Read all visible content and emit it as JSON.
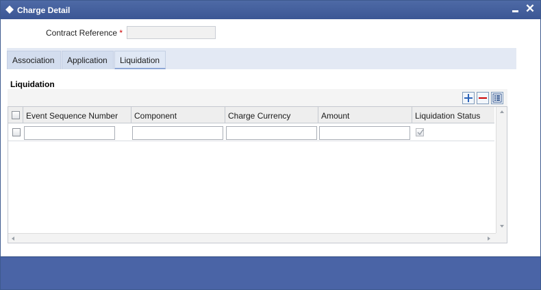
{
  "window": {
    "title": "Charge Detail",
    "title_icon": "diamond-icon",
    "minimize_icon": "minimize-icon",
    "close_icon": "close-icon",
    "close_glyph": "✕"
  },
  "header": {
    "contract_reference_label": "Contract Reference",
    "required_marker": "*",
    "contract_reference_value": ""
  },
  "tabs": [
    {
      "label": "Association"
    },
    {
      "label": "Application"
    },
    {
      "label": "Liquidation",
      "active": true
    }
  ],
  "section": {
    "title": "Liquidation"
  },
  "toolbar": {
    "add_icon": "plus-icon",
    "delete_icon": "minus-icon",
    "view_icon": "list-view-icon"
  },
  "grid": {
    "columns": [
      {
        "label": "Event Sequence Number"
      },
      {
        "label": "Component"
      },
      {
        "label": "Charge Currency"
      },
      {
        "label": "Amount"
      },
      {
        "label": "Liquidation Status"
      }
    ],
    "rows": [
      {
        "selected": false,
        "event_sequence_number": "",
        "component": "",
        "charge_currency": "",
        "amount": "",
        "liquidation_status": true
      }
    ]
  },
  "colors": {
    "titlebar": "#3b5694",
    "footer": "#4a64a6",
    "tab_strip": "#e3e9f4",
    "required": "#cc0000",
    "toolbar_add": "#2a62b8",
    "toolbar_delete": "#cc0000"
  }
}
